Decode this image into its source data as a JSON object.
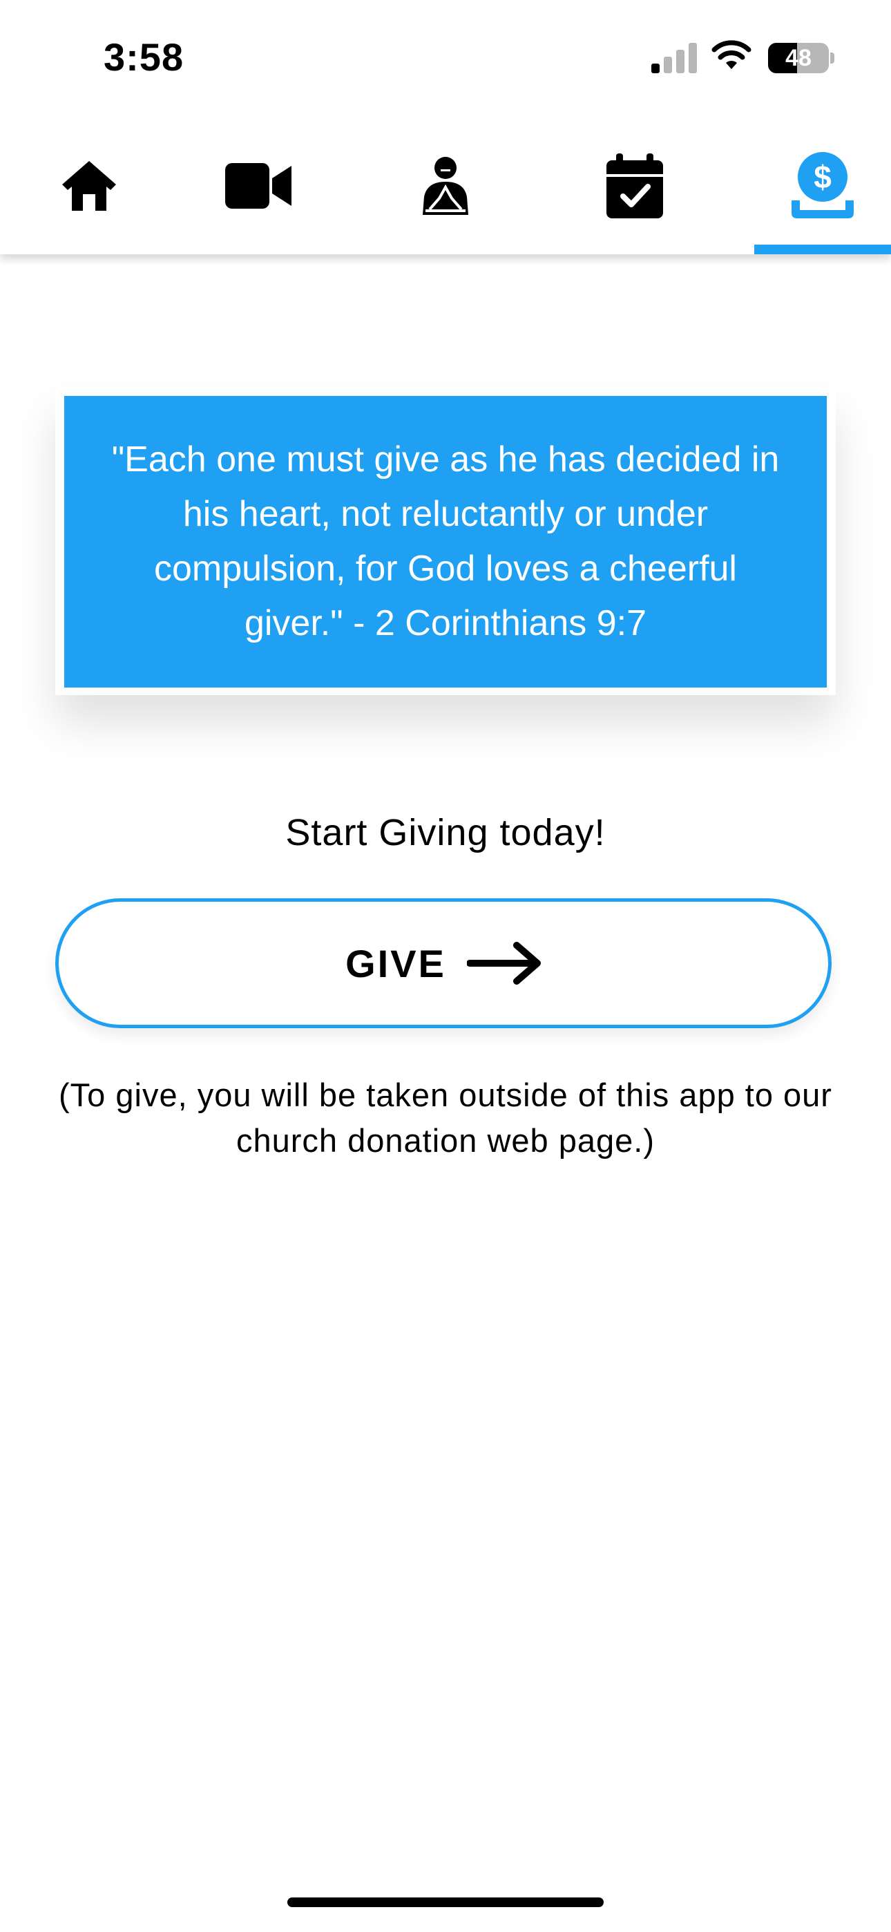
{
  "status_bar": {
    "time": "3:58",
    "battery_level": "48",
    "battery_fraction": 0.48,
    "signal_bars_active": 1,
    "signal_bars_total": 4
  },
  "tabs": [
    {
      "name": "home",
      "icon": "home-icon",
      "active": false
    },
    {
      "name": "video",
      "icon": "video-camera-icon",
      "active": false
    },
    {
      "name": "prayer",
      "icon": "praying-person-icon",
      "active": false
    },
    {
      "name": "events",
      "icon": "calendar-check-icon",
      "active": false
    },
    {
      "name": "give",
      "icon": "hand-dollar-icon",
      "active": true
    }
  ],
  "colors": {
    "accent": "#1fa0f2",
    "text": "#000000",
    "background": "#ffffff"
  },
  "quote": {
    "text": "\"Each one must give as he has decided in his heart, not reluctantly or under compulsion, for God loves a cheerful giver.\" - 2 Corinthians 9:7"
  },
  "cta": {
    "title": "Start Giving today!",
    "button_label": "GIVE",
    "button_icon": "arrow-right-icon",
    "disclaimer": "(To give, you will be taken outside of this app to our church donation web page.)"
  }
}
